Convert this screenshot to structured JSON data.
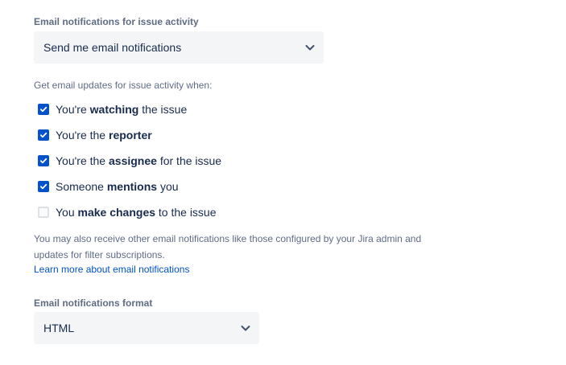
{
  "issue_activity": {
    "label": "Email notifications for issue activity",
    "select_value": "Send me email notifications",
    "chevron_icon": "chevron-down-icon"
  },
  "updates": {
    "helper": "Get email updates for issue activity when:",
    "options": [
      {
        "pre": "You're ",
        "bold": "watching",
        "post": " the issue",
        "checked": true
      },
      {
        "pre": "You're the ",
        "bold": "reporter",
        "post": "",
        "checked": true
      },
      {
        "pre": "You're the ",
        "bold": "assignee",
        "post": " for the issue",
        "checked": true
      },
      {
        "pre": "Someone ",
        "bold": "mentions",
        "post": " you",
        "checked": true
      },
      {
        "pre": "You ",
        "bold": "make changes",
        "post": " to the issue",
        "checked": false
      }
    ]
  },
  "note": {
    "text_line1": "You may also receive other email notifications like those configured by your Jira admin and",
    "text_line2": "updates for filter subscriptions.",
    "link": "Learn more about email notifications"
  },
  "format": {
    "label": "Email notifications format",
    "select_value": "HTML",
    "chevron_icon": "chevron-down-icon"
  },
  "colors": {
    "accent": "#0052cc",
    "text": "#172b4d",
    "subtle": "#5e6c84",
    "field_bg": "#f4f5f7"
  }
}
